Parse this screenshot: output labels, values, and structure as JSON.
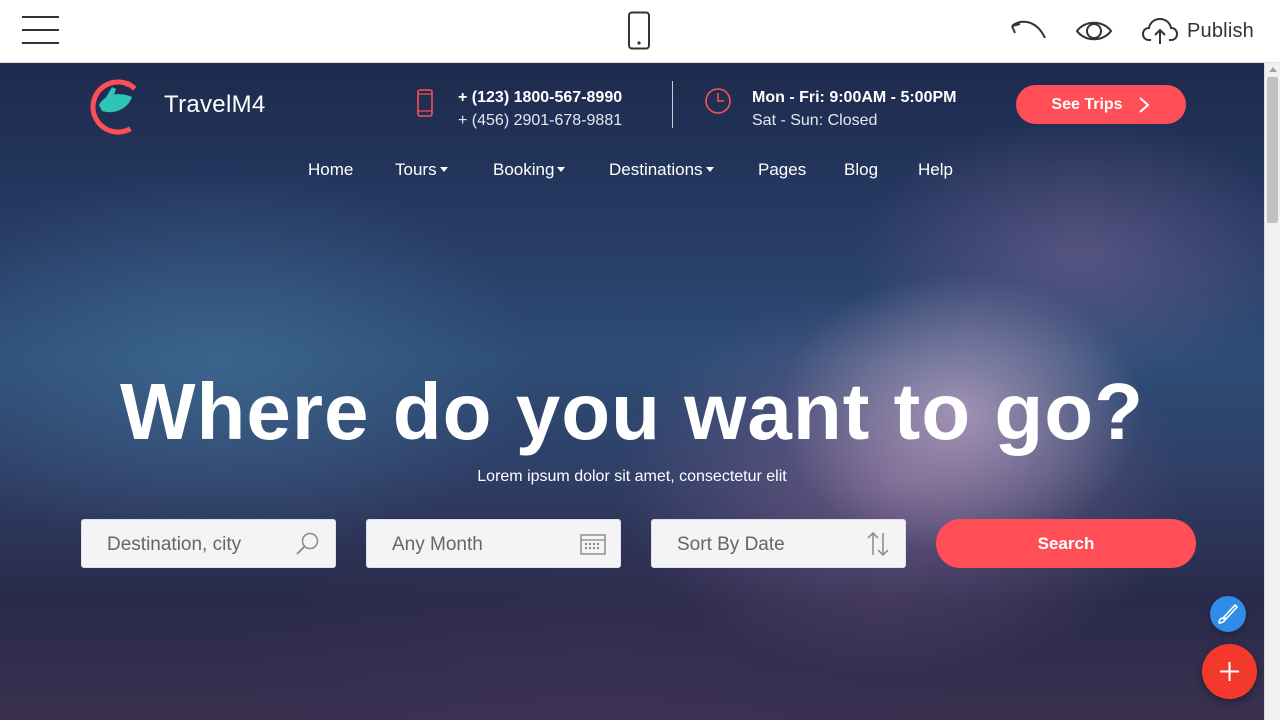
{
  "editor": {
    "menu_icon": "hamburger-icon",
    "device_icon": "mobile-phone-icon",
    "undo_icon": "undo-icon",
    "preview_icon": "eye-icon",
    "publish_icon": "cloud-upload-icon",
    "publish_label": "Publish"
  },
  "site": {
    "logo_text": "TravelM4",
    "phone": {
      "icon": "mobile-phone-icon",
      "primary": "+ (123) 1800-567-8990",
      "secondary": "+ (456) 2901-678-9881"
    },
    "hours": {
      "icon": "clock-icon",
      "primary": "Mon - Fri: 9:00AM - 5:00PM",
      "secondary": "Sat - Sun: Closed"
    },
    "cta_label": "See Trips",
    "nav": [
      {
        "label": "Home"
      },
      {
        "label": "Tours"
      },
      {
        "label": "Booking"
      },
      {
        "label": "Destinations"
      },
      {
        "label": "Pages"
      },
      {
        "label": "Blog"
      },
      {
        "label": "Help"
      }
    ],
    "hero_title": "Where do you want to go?",
    "hero_subtitle": "Lorem ipsum dolor sit amet, consectetur elit",
    "search_form": {
      "destination_placeholder": "Destination, city",
      "month_placeholder": "Any Month",
      "sort_placeholder": "Sort By Date",
      "search_label": "Search"
    }
  },
  "colors": {
    "accent": "#ff4e56",
    "fab_blue": "#2f8de8",
    "fab_red": "#f2392c",
    "logo_teal": "#2ec4b6"
  }
}
